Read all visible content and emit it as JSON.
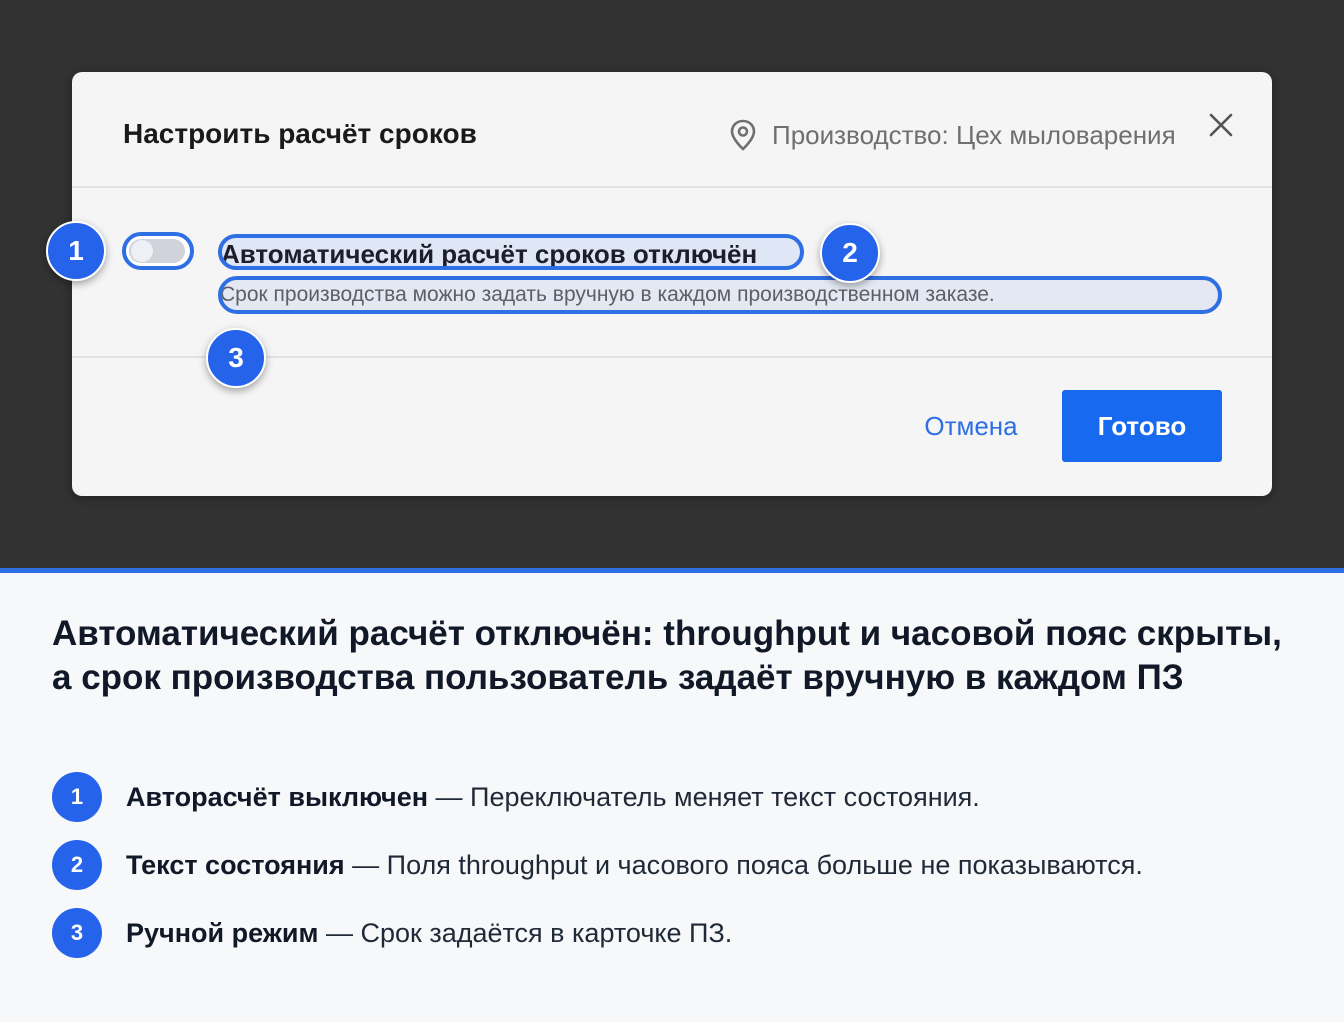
{
  "dialog": {
    "title": "Настроить расчёт сроков",
    "location": "Производство: Цех мыловарения",
    "status_title": "Автоматический расчёт сроков отключён",
    "status_description": "Срок производства можно задать вручную в каждом производственном заказе.",
    "toggle_on": false,
    "cancel_label": "Отмена",
    "done_label": "Готово"
  },
  "badges": [
    "1",
    "2",
    "3"
  ],
  "caption": "Автоматический расчёт отключён: throughput и часовой пояс скрыты, а срок производства пользователь задаёт вручную в каждом ПЗ",
  "legend": [
    {
      "num": "1",
      "term": "Авторасчёт выключен",
      "text": " — Переключатель меняет текст состояния."
    },
    {
      "num": "2",
      "term": "Текст состояния",
      "text": " — Поля throughput и часового пояса больше не показываются."
    },
    {
      "num": "3",
      "term": "Ручной режим",
      "text": " — Срок задаётся в карточке ПЗ."
    }
  ],
  "colors": {
    "accent": "#2f6fe4",
    "primary_button": "#1769f0",
    "backdrop": "#323232"
  }
}
